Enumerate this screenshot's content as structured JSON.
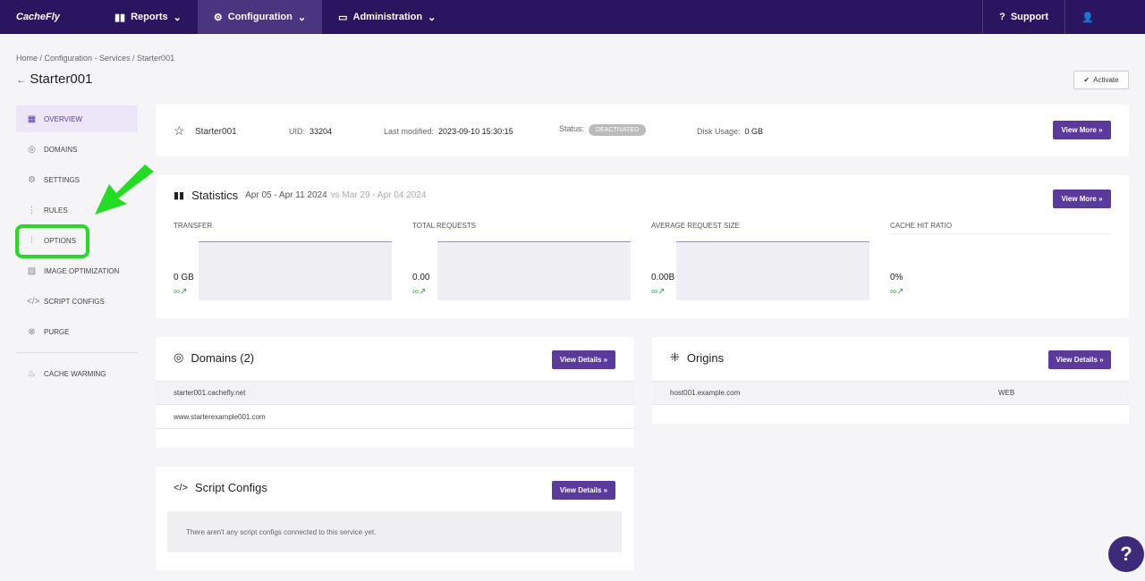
{
  "topnav": {
    "logo": "CacheFly",
    "reports": "Reports",
    "configuration": "Configuration",
    "administration": "Administration",
    "support": "Support"
  },
  "breadcrumb": "Home / Configuration - Services / Starter001",
  "page_title": "Starter001",
  "activate": "Activate",
  "sidebar": [
    {
      "label": "OVERVIEW",
      "icon": "overview-icon"
    },
    {
      "label": "DOMAINS",
      "icon": "globe-icon"
    },
    {
      "label": "SETTINGS",
      "icon": "gear-icon"
    },
    {
      "label": "RULES",
      "icon": "rules-icon"
    },
    {
      "label": "OPTIONS",
      "icon": "sliders-icon"
    },
    {
      "label": "IMAGE OPTIMIZATION",
      "icon": "image-icon"
    },
    {
      "label": "SCRIPT CONFIGS",
      "icon": "code-icon"
    },
    {
      "label": "PURGE",
      "icon": "purge-icon"
    },
    {
      "label": "CACHE WARMING",
      "icon": "flame-icon"
    }
  ],
  "summary": {
    "name": "Starter001",
    "uid_label": "UID:",
    "uid": "33204",
    "modified_label": "Last modified:",
    "modified": "2023-09-10 15:30:15",
    "status_label": "Status:",
    "status": "DEACTIVATED",
    "disk_label": "Disk Usage:",
    "disk": "0 GB",
    "button": "View More »"
  },
  "statistics": {
    "title": "Statistics",
    "range": "Apr 05 - Apr 11 2024",
    "compare": "vs Mar 29 - Apr 04 2024",
    "button": "View More »",
    "items": [
      {
        "label": "TRANSFER",
        "value": "0 GB",
        "change": "∞↗"
      },
      {
        "label": "TOTAL REQUESTS",
        "value": "0.00",
        "change": "∞↗"
      },
      {
        "label": "AVERAGE REQUEST SIZE",
        "value": "0.00B",
        "change": "∞↗"
      },
      {
        "label": "CACHE HIT RATIO",
        "value": "0%",
        "change": "∞↗"
      }
    ]
  },
  "domains": {
    "title": "Domains (2)",
    "button": "View Details »",
    "rows": [
      "starter001.cachefly.net",
      "www.starterexample001.com"
    ]
  },
  "origins": {
    "title": "Origins",
    "button": "View Details »",
    "rows": [
      {
        "host": "host001.example.com",
        "type": "WEB"
      }
    ]
  },
  "scripts": {
    "title": "Script Configs",
    "button": "View Details »",
    "empty": "There aren't any script configs connected to this service yet."
  },
  "highlight_color": "#22dd22"
}
